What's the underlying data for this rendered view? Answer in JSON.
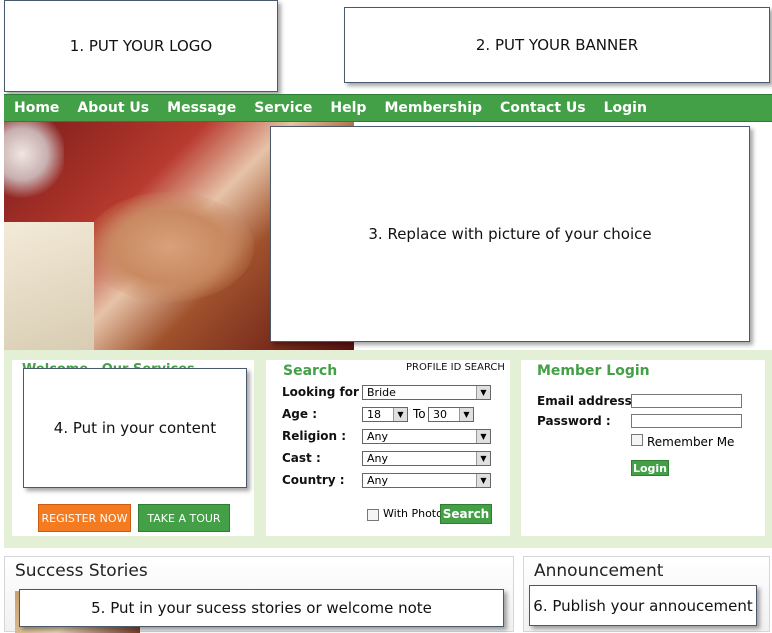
{
  "placeholders": {
    "logo": "1. PUT YOUR LOGO",
    "banner": "2. PUT YOUR BANNER",
    "picture": "3. Replace with picture of your choice",
    "content": "4. Put in your content",
    "stories": "5. Put in your sucess stories or welcome note",
    "announcement": "6. Publish your annoucement"
  },
  "nav": [
    "Home",
    "About Us",
    "Message",
    "Service",
    "Help",
    "Membership",
    "Contact Us",
    "Login"
  ],
  "welcome": {
    "title": "Welcome   Our Services",
    "register_label": "REGISTER NOW",
    "tour_label": "TAKE A TOUR"
  },
  "search": {
    "title": "Search",
    "profile_link": "PROFILE ID SEARCH",
    "looking_for_label": "Looking for :",
    "looking_for_value": "Bride",
    "age_label": "Age :",
    "age_from": "18",
    "age_to_label": "To",
    "age_to": "30",
    "religion_label": "Religion :",
    "religion_value": "Any",
    "cast_label": "Cast :",
    "cast_value": "Any",
    "country_label": "Country :",
    "country_value": "Any",
    "with_photo_label": "With Photo",
    "search_button": "Search"
  },
  "login": {
    "title": "Member Login",
    "email_label": "Email address :",
    "password_label": "Password :",
    "remember_label": "Remember Me",
    "login_button": "Login"
  },
  "sections": {
    "success_title": "Success Stories",
    "announcement_title": "Announcement"
  },
  "colors": {
    "nav_green": "#43a047",
    "band_green": "#e4f0d5",
    "register_orange": "#f47b20"
  }
}
